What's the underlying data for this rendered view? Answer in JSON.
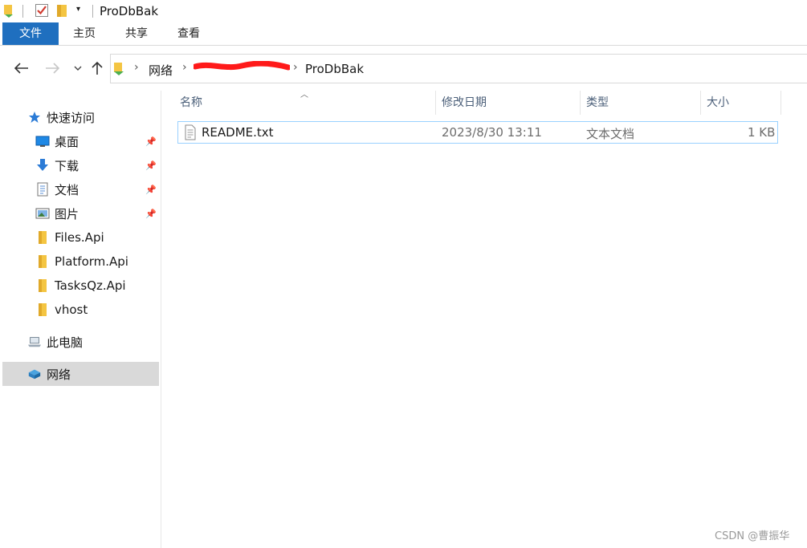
{
  "window": {
    "title": "ProDbBak"
  },
  "ribbon": {
    "tabs": [
      "文件",
      "主页",
      "共享",
      "查看"
    ]
  },
  "address": {
    "crumbs": [
      "网络",
      "ProDbBak"
    ]
  },
  "sidebar": {
    "quick_access": "快速访问",
    "pinned": [
      {
        "label": "桌面",
        "icon": "desktop-icon"
      },
      {
        "label": "下载",
        "icon": "download-icon"
      },
      {
        "label": "文档",
        "icon": "documents-icon"
      },
      {
        "label": "图片",
        "icon": "pictures-icon"
      }
    ],
    "folders": [
      "Files.Api",
      "Platform.Api",
      "TasksQz.Api",
      "vhost"
    ],
    "this_pc": "此电脑",
    "network": "网络"
  },
  "columns": {
    "name": "名称",
    "modified": "修改日期",
    "type": "类型",
    "size": "大小"
  },
  "files": [
    {
      "name": "README.txt",
      "modified": "2023/8/30 13:11",
      "type": "文本文档",
      "size": "1 KB"
    }
  ],
  "watermark": "CSDN @曹振华",
  "colors": {
    "file_tab": "#1f6fbf",
    "selection_border": "#99d1ff",
    "header_text": "#4c607a",
    "folder_yellow": "#f4c542"
  }
}
